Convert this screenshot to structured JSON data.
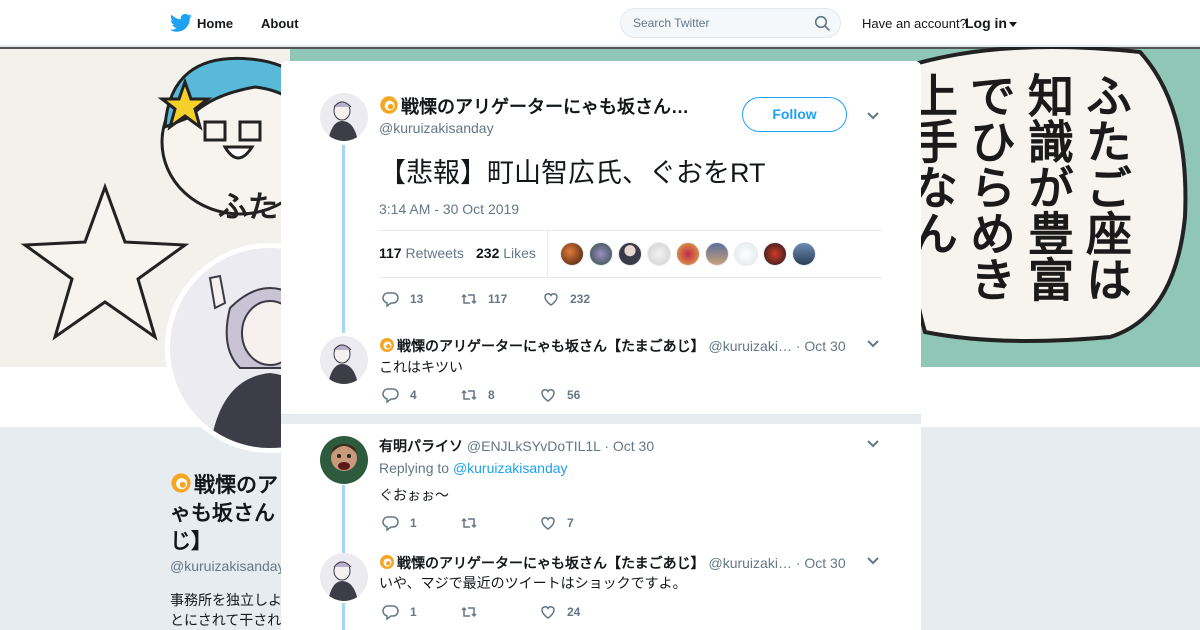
{
  "topbar": {
    "home_label": "Home",
    "about_label": "About",
    "search_placeholder": "Search Twitter",
    "have_account": "Have an account?",
    "login_label": "Log in"
  },
  "profile": {
    "name": "戦慄のアリゲーターにゃも坂さん【たまごあじ】",
    "name_visible": "戦慄のア\nゃも坂さん\nじ】",
    "handle": "@kuruizakisanday",
    "bio_snippet": "事務所を独立しよ\nとにされて干され"
  },
  "banner": {
    "speech_text": "ふたご座は\n知識が豊富\nでひらめき\n上手なん",
    "side_text": "ふた"
  },
  "main_tweet": {
    "author_name": "戦慄のアリゲーターにゃも坂さん…",
    "author_handle": "@kuruizakisanday",
    "follow_label": "Follow",
    "text": "【悲報】町山智広氏、ぐおをRT",
    "timestamp": "3:14 AM - 30 Oct 2019",
    "retweets_count": "117",
    "retweets_label": "Retweets",
    "likes_count": "232",
    "likes_label": "Likes",
    "action_replies": "13",
    "action_retweets": "117",
    "action_likes": "232"
  },
  "replies": [
    {
      "author_name": "戦慄のアリゲーターにゃも坂さん【たまごあじ】",
      "author_handle": "@kuruizaki…",
      "date": "· Oct 30",
      "text": "これはキツい",
      "replies": "4",
      "retweets": "8",
      "likes": "56"
    },
    {
      "author_name": "有明パライソ",
      "author_handle": "@ENJLkSYvDoTIL1L",
      "date": "· Oct 30",
      "replying_prefix": "Replying to",
      "replying_to": "@kuruizakisanday",
      "text": "ぐおぉぉ～",
      "replies": "1",
      "retweets": "",
      "likes": "7"
    },
    {
      "author_name": "戦慄のアリゲーターにゃも坂さん【たまごあじ】",
      "author_handle": "@kuruizaki…",
      "date": "· Oct 30",
      "text": "いや、マジで最近のツイートはショックですよ。",
      "replies": "1",
      "retweets": "",
      "likes": "24"
    }
  ],
  "colors": {
    "accent": "#1da1f2",
    "thread_line": "#a2d8f2",
    "banner": "#8fc6b6",
    "muted_text": "#657786"
  }
}
